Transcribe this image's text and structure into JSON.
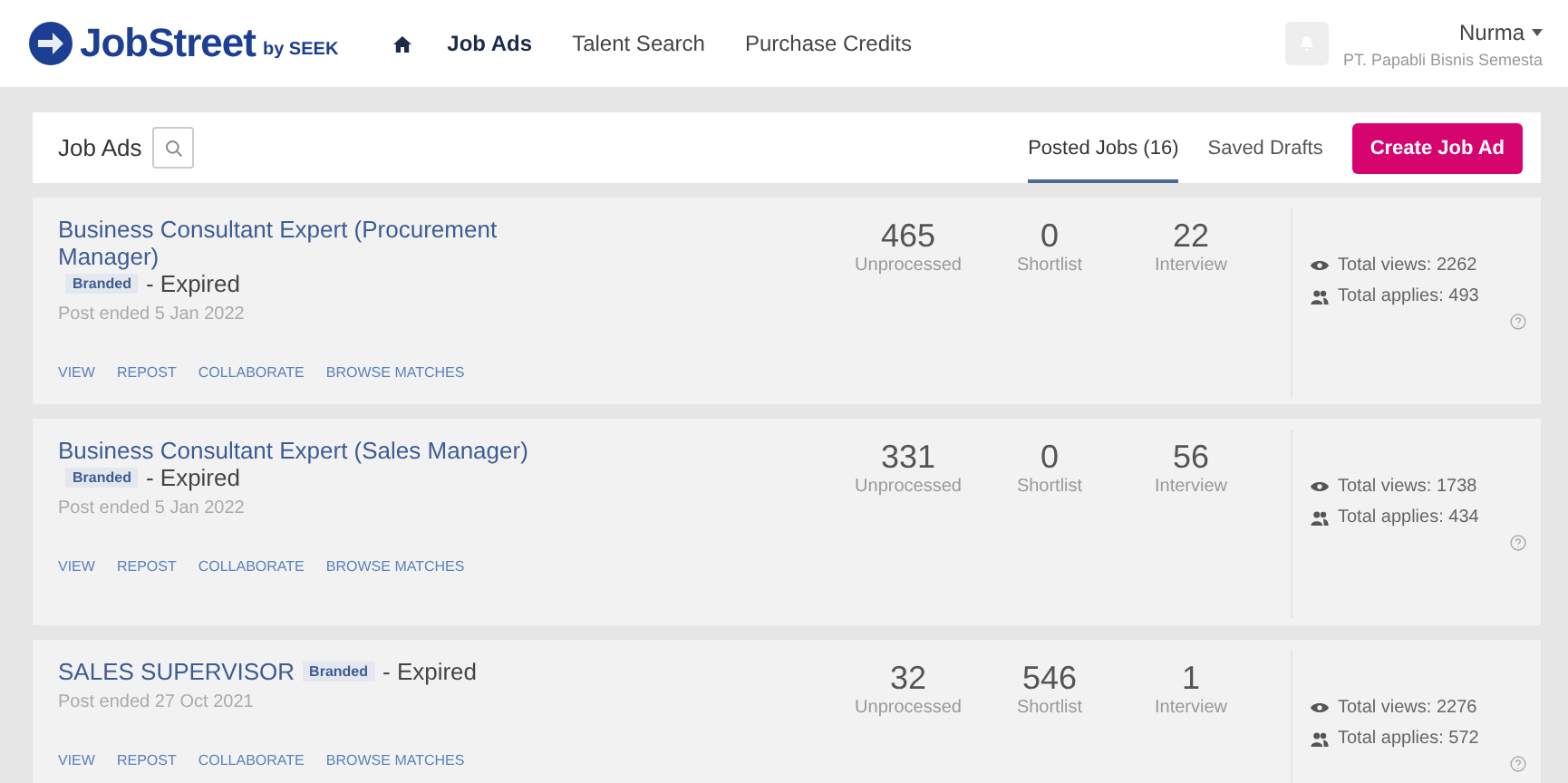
{
  "header": {
    "logo": {
      "name": "JobStreet",
      "suffix": "by SEEK"
    },
    "nav": [
      {
        "label": "Job Ads",
        "selected": true
      },
      {
        "label": "Talent Search",
        "selected": false
      },
      {
        "label": "Purchase Credits",
        "selected": false
      }
    ],
    "user": {
      "name": "Nurma",
      "company": "PT. Papabli Bisnis Semesta"
    }
  },
  "toolbar": {
    "title": "Job Ads",
    "tabs": [
      {
        "label": "Posted Jobs (16)",
        "selected": true
      },
      {
        "label": "Saved Drafts",
        "selected": false
      }
    ],
    "create_button": "Create Job Ad"
  },
  "jobs": [
    {
      "title": "Business Consultant Expert (Procurement Manager)",
      "badge": "Branded",
      "status": "- Expired",
      "posted": "Post ended 5 Jan 2022",
      "actions": [
        "VIEW",
        "REPOST",
        "COLLABORATE",
        "BROWSE MATCHES"
      ],
      "stats": [
        {
          "value": "465",
          "label": "Unprocessed"
        },
        {
          "value": "0",
          "label": "Shortlist"
        },
        {
          "value": "22",
          "label": "Interview"
        }
      ],
      "views": "Total views: 2262",
      "applies": "Total applies: 493"
    },
    {
      "title": "Business Consultant Expert (Sales Manager)",
      "badge": "Branded",
      "status": "- Expired",
      "posted": "Post ended 5 Jan 2022",
      "actions": [
        "VIEW",
        "REPOST",
        "COLLABORATE",
        "BROWSE MATCHES"
      ],
      "stats": [
        {
          "value": "331",
          "label": "Unprocessed"
        },
        {
          "value": "0",
          "label": "Shortlist"
        },
        {
          "value": "56",
          "label": "Interview"
        }
      ],
      "views": "Total views: 1738",
      "applies": "Total applies: 434"
    },
    {
      "title": "SALES SUPERVISOR",
      "badge": "Branded",
      "status": "- Expired",
      "posted": "Post ended 27 Oct 2021",
      "actions": [
        "VIEW",
        "REPOST",
        "COLLABORATE",
        "BROWSE MATCHES"
      ],
      "stats": [
        {
          "value": "32",
          "label": "Unprocessed"
        },
        {
          "value": "546",
          "label": "Shortlist"
        },
        {
          "value": "1",
          "label": "Interview"
        }
      ],
      "views": "Total views: 2276",
      "applies": "Total applies: 572"
    }
  ]
}
